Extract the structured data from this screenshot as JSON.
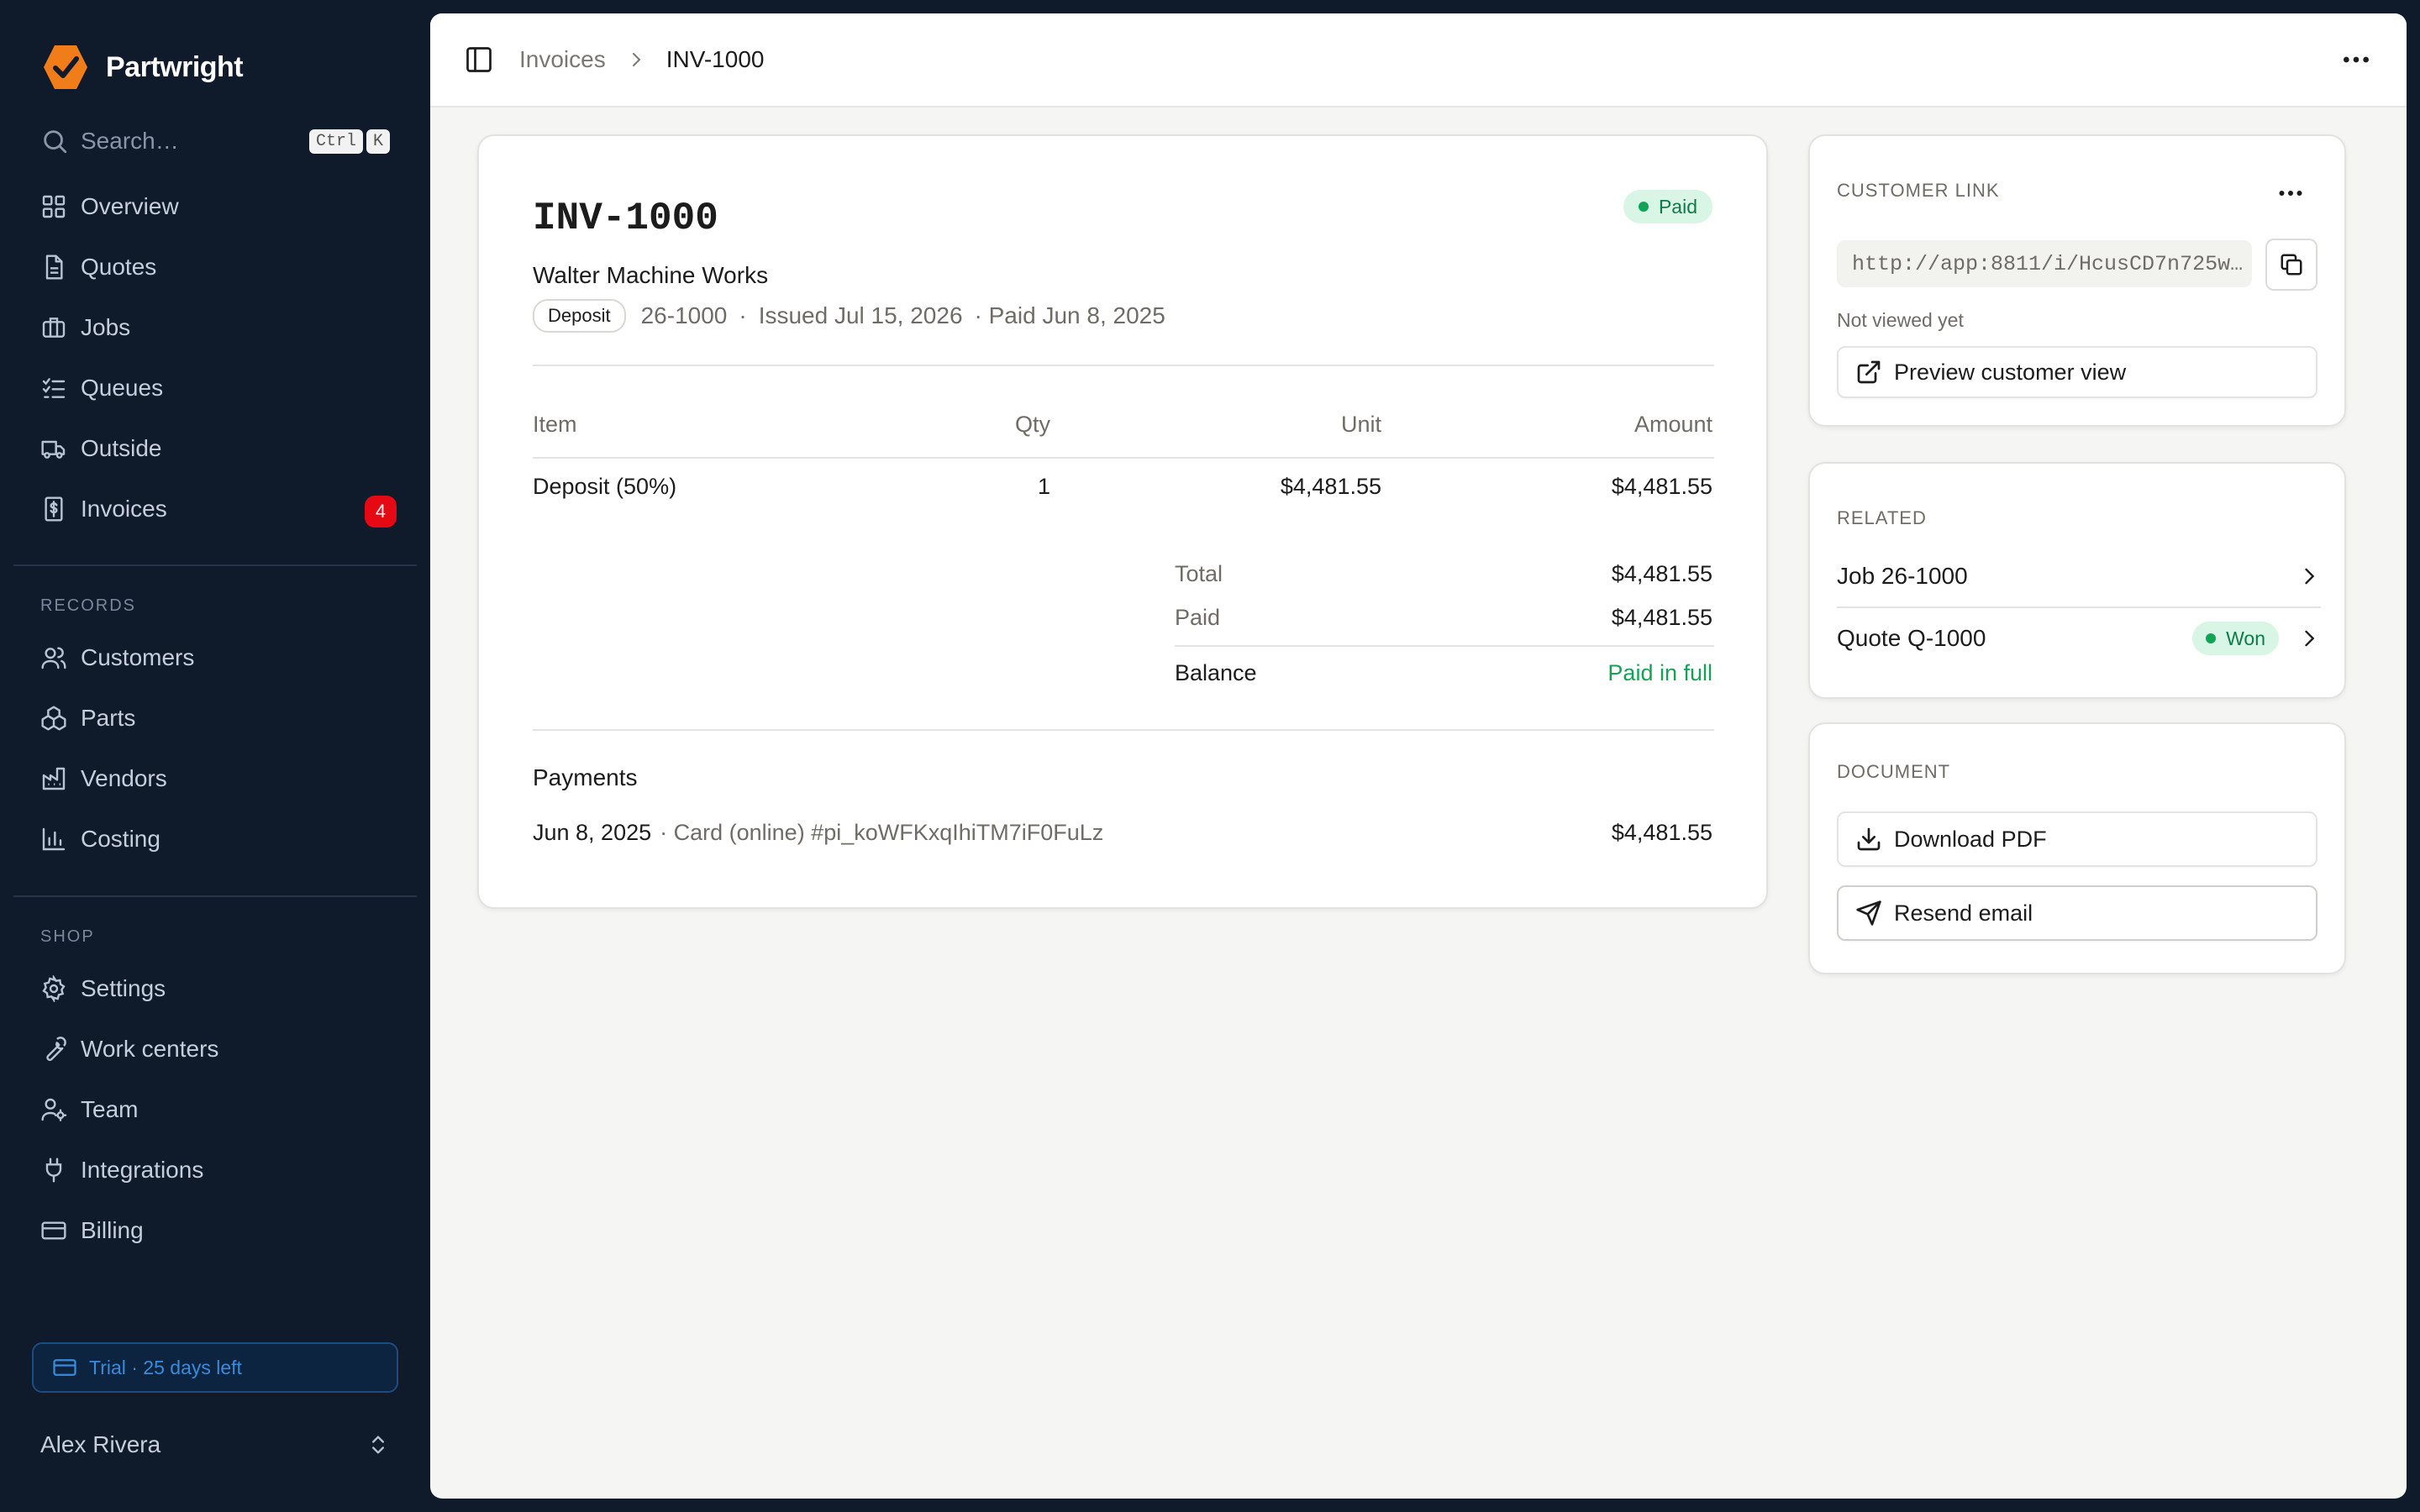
{
  "app": {
    "name": "Partwright"
  },
  "search": {
    "placeholder": "Search…",
    "kbd1": "Ctrl",
    "kbd2": "K"
  },
  "nav_main": [
    {
      "label": "Overview",
      "icon": "grid-icon"
    },
    {
      "label": "Quotes",
      "icon": "file-icon"
    },
    {
      "label": "Jobs",
      "icon": "briefcase-icon"
    },
    {
      "label": "Queues",
      "icon": "list-check-icon"
    },
    {
      "label": "Outside",
      "icon": "truck-icon"
    },
    {
      "label": "Invoices",
      "icon": "receipt-dollar-icon",
      "badge": "4"
    }
  ],
  "records": {
    "title": "RECORDS",
    "items": [
      {
        "label": "Customers",
        "icon": "users-icon"
      },
      {
        "label": "Parts",
        "icon": "boxes-icon"
      },
      {
        "label": "Vendors",
        "icon": "factory-icon"
      },
      {
        "label": "Costing",
        "icon": "bar-chart-icon"
      }
    ]
  },
  "shop": {
    "title": "SHOP",
    "items": [
      {
        "label": "Settings",
        "icon": "gear-icon"
      },
      {
        "label": "Work centers",
        "icon": "wrench-icon"
      },
      {
        "label": "Team",
        "icon": "user-cog-icon"
      },
      {
        "label": "Integrations",
        "icon": "plug-icon"
      },
      {
        "label": "Billing",
        "icon": "credit-card-icon"
      }
    ]
  },
  "trial": {
    "text": "Trial · 25 days left"
  },
  "user": {
    "name": "Alex Rivera"
  },
  "breadcrumb": {
    "parent": "Invoices",
    "current": "INV-1000"
  },
  "invoice": {
    "number": "INV-1000",
    "status": "Paid",
    "customer": "Walter Machine Works",
    "type_tag": "Deposit",
    "job": "26-1000",
    "issued": "Issued Jul 15, 2026",
    "paid_on": "· Paid Jun 8, 2025",
    "dot_sep": "·",
    "columns": {
      "item": "Item",
      "qty": "Qty",
      "unit": "Unit",
      "amount": "Amount"
    },
    "lines": [
      {
        "item": "Deposit (50%)",
        "qty": "1",
        "unit": "$4,481.55",
        "amount": "$4,481.55"
      }
    ],
    "totals": {
      "total_label": "Total",
      "total": "$4,481.55",
      "paid_label": "Paid",
      "paid": "$4,481.55",
      "balance_label": "Balance",
      "balance": "Paid in full"
    },
    "payments_title": "Payments",
    "payments": [
      {
        "date": "Jun 8, 2025",
        "desc": "· Card (online) #pi_koWFKxqIhiTM7iF0FuLz",
        "amount": "$4,481.55"
      }
    ]
  },
  "customer_link": {
    "title": "CUSTOMER LINK",
    "url": "http://app:8811/i/HcusCD7n725w…",
    "viewed": "Not viewed yet",
    "preview_label": "Preview customer view"
  },
  "related": {
    "title": "RELATED",
    "job_label": "Job 26-1000",
    "quote_label": "Quote Q-1000",
    "quote_status": "Won"
  },
  "document": {
    "title": "DOCUMENT",
    "download_label": "Download PDF",
    "resend_label": "Resend email"
  },
  "colors": {
    "sidebar_bg": "#0f1a2b",
    "brand_orange": "#f07d1a",
    "badge_red": "#e50914",
    "success_green": "#14a356"
  }
}
